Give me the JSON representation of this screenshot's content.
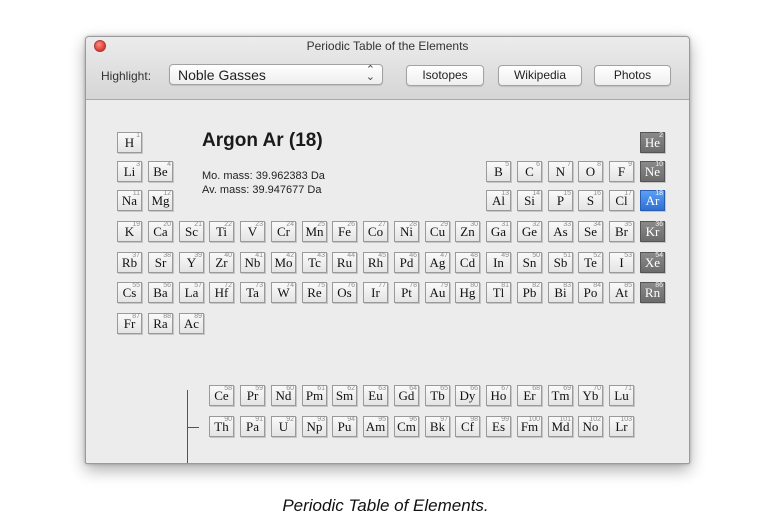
{
  "window": {
    "title": "Periodic Table of the Elements"
  },
  "toolbar": {
    "highlight_label": "Highlight:",
    "highlight_value": "Noble Gasses",
    "buttons": [
      "Isotopes",
      "Wikipedia",
      "Photos"
    ]
  },
  "selected": {
    "heading": "Argon Ar (18)",
    "mo_mass": "Mo. mass: 39.962383 Da",
    "av_mass": "Av. mass: 39.947677 Da"
  },
  "caption": "Periodic Table of Elements.",
  "colors": {
    "noble": "#767676",
    "selected": "#3d7fe0"
  },
  "elements": [
    {
      "n": 1,
      "s": "H",
      "p": 1,
      "g": 1
    },
    {
      "n": 2,
      "s": "He",
      "p": 1,
      "g": 18,
      "noble": true
    },
    {
      "n": 3,
      "s": "Li",
      "p": 2,
      "g": 1
    },
    {
      "n": 4,
      "s": "Be",
      "p": 2,
      "g": 2
    },
    {
      "n": 5,
      "s": "B",
      "p": 2,
      "g": 13
    },
    {
      "n": 6,
      "s": "C",
      "p": 2,
      "g": 14
    },
    {
      "n": 7,
      "s": "N",
      "p": 2,
      "g": 15
    },
    {
      "n": 8,
      "s": "O",
      "p": 2,
      "g": 16
    },
    {
      "n": 9,
      "s": "F",
      "p": 2,
      "g": 17
    },
    {
      "n": 10,
      "s": "Ne",
      "p": 2,
      "g": 18,
      "noble": true
    },
    {
      "n": 11,
      "s": "Na",
      "p": 3,
      "g": 1
    },
    {
      "n": 12,
      "s": "Mg",
      "p": 3,
      "g": 2
    },
    {
      "n": 13,
      "s": "Al",
      "p": 3,
      "g": 13
    },
    {
      "n": 14,
      "s": "Si",
      "p": 3,
      "g": 14
    },
    {
      "n": 15,
      "s": "P",
      "p": 3,
      "g": 15
    },
    {
      "n": 16,
      "s": "S",
      "p": 3,
      "g": 16
    },
    {
      "n": 17,
      "s": "Cl",
      "p": 3,
      "g": 17
    },
    {
      "n": 18,
      "s": "Ar",
      "p": 3,
      "g": 18,
      "selected": true
    },
    {
      "n": 19,
      "s": "K",
      "p": 4,
      "g": 1
    },
    {
      "n": 20,
      "s": "Ca",
      "p": 4,
      "g": 2
    },
    {
      "n": 21,
      "s": "Sc",
      "p": 4,
      "g": 3
    },
    {
      "n": 22,
      "s": "Ti",
      "p": 4,
      "g": 4
    },
    {
      "n": 23,
      "s": "V",
      "p": 4,
      "g": 5
    },
    {
      "n": 24,
      "s": "Cr",
      "p": 4,
      "g": 6
    },
    {
      "n": 25,
      "s": "Mn",
      "p": 4,
      "g": 7
    },
    {
      "n": 26,
      "s": "Fe",
      "p": 4,
      "g": 8
    },
    {
      "n": 27,
      "s": "Co",
      "p": 4,
      "g": 9
    },
    {
      "n": 28,
      "s": "Ni",
      "p": 4,
      "g": 10
    },
    {
      "n": 29,
      "s": "Cu",
      "p": 4,
      "g": 11
    },
    {
      "n": 30,
      "s": "Zn",
      "p": 4,
      "g": 12
    },
    {
      "n": 31,
      "s": "Ga",
      "p": 4,
      "g": 13
    },
    {
      "n": 32,
      "s": "Ge",
      "p": 4,
      "g": 14
    },
    {
      "n": 33,
      "s": "As",
      "p": 4,
      "g": 15
    },
    {
      "n": 34,
      "s": "Se",
      "p": 4,
      "g": 16
    },
    {
      "n": 35,
      "s": "Br",
      "p": 4,
      "g": 17
    },
    {
      "n": 36,
      "s": "Kr",
      "p": 4,
      "g": 18,
      "noble": true
    },
    {
      "n": 37,
      "s": "Rb",
      "p": 5,
      "g": 1
    },
    {
      "n": 38,
      "s": "Sr",
      "p": 5,
      "g": 2
    },
    {
      "n": 39,
      "s": "Y",
      "p": 5,
      "g": 3
    },
    {
      "n": 40,
      "s": "Zr",
      "p": 5,
      "g": 4
    },
    {
      "n": 41,
      "s": "Nb",
      "p": 5,
      "g": 5
    },
    {
      "n": 42,
      "s": "Mo",
      "p": 5,
      "g": 6
    },
    {
      "n": 43,
      "s": "Tc",
      "p": 5,
      "g": 7
    },
    {
      "n": 44,
      "s": "Ru",
      "p": 5,
      "g": 8
    },
    {
      "n": 45,
      "s": "Rh",
      "p": 5,
      "g": 9
    },
    {
      "n": 46,
      "s": "Pd",
      "p": 5,
      "g": 10
    },
    {
      "n": 47,
      "s": "Ag",
      "p": 5,
      "g": 11
    },
    {
      "n": 48,
      "s": "Cd",
      "p": 5,
      "g": 12
    },
    {
      "n": 49,
      "s": "In",
      "p": 5,
      "g": 13
    },
    {
      "n": 50,
      "s": "Sn",
      "p": 5,
      "g": 14
    },
    {
      "n": 51,
      "s": "Sb",
      "p": 5,
      "g": 15
    },
    {
      "n": 52,
      "s": "Te",
      "p": 5,
      "g": 16
    },
    {
      "n": 53,
      "s": "I",
      "p": 5,
      "g": 17
    },
    {
      "n": 54,
      "s": "Xe",
      "p": 5,
      "g": 18,
      "noble": true
    },
    {
      "n": 55,
      "s": "Cs",
      "p": 6,
      "g": 1
    },
    {
      "n": 56,
      "s": "Ba",
      "p": 6,
      "g": 2
    },
    {
      "n": 57,
      "s": "La",
      "p": 6,
      "g": 3
    },
    {
      "n": 72,
      "s": "Hf",
      "p": 6,
      "g": 4
    },
    {
      "n": 73,
      "s": "Ta",
      "p": 6,
      "g": 5
    },
    {
      "n": 74,
      "s": "W",
      "p": 6,
      "g": 6
    },
    {
      "n": 75,
      "s": "Re",
      "p": 6,
      "g": 7
    },
    {
      "n": 76,
      "s": "Os",
      "p": 6,
      "g": 8
    },
    {
      "n": 77,
      "s": "Ir",
      "p": 6,
      "g": 9
    },
    {
      "n": 78,
      "s": "Pt",
      "p": 6,
      "g": 10
    },
    {
      "n": 79,
      "s": "Au",
      "p": 6,
      "g": 11
    },
    {
      "n": 80,
      "s": "Hg",
      "p": 6,
      "g": 12
    },
    {
      "n": 81,
      "s": "Tl",
      "p": 6,
      "g": 13
    },
    {
      "n": 82,
      "s": "Pb",
      "p": 6,
      "g": 14
    },
    {
      "n": 83,
      "s": "Bi",
      "p": 6,
      "g": 15
    },
    {
      "n": 84,
      "s": "Po",
      "p": 6,
      "g": 16
    },
    {
      "n": 85,
      "s": "At",
      "p": 6,
      "g": 17
    },
    {
      "n": 86,
      "s": "Rn",
      "p": 6,
      "g": 18,
      "noble": true
    },
    {
      "n": 87,
      "s": "Fr",
      "p": 7,
      "g": 1
    },
    {
      "n": 88,
      "s": "Ra",
      "p": 7,
      "g": 2
    },
    {
      "n": 89,
      "s": "Ac",
      "p": 7,
      "g": 3
    },
    {
      "n": 58,
      "s": "Ce",
      "p": 9,
      "g": 4
    },
    {
      "n": 59,
      "s": "Pr",
      "p": 9,
      "g": 5
    },
    {
      "n": 60,
      "s": "Nd",
      "p": 9,
      "g": 6
    },
    {
      "n": 61,
      "s": "Pm",
      "p": 9,
      "g": 7
    },
    {
      "n": 62,
      "s": "Sm",
      "p": 9,
      "g": 8
    },
    {
      "n": 63,
      "s": "Eu",
      "p": 9,
      "g": 9
    },
    {
      "n": 64,
      "s": "Gd",
      "p": 9,
      "g": 10
    },
    {
      "n": 65,
      "s": "Tb",
      "p": 9,
      "g": 11
    },
    {
      "n": 66,
      "s": "Dy",
      "p": 9,
      "g": 12
    },
    {
      "n": 67,
      "s": "Ho",
      "p": 9,
      "g": 13
    },
    {
      "n": 68,
      "s": "Er",
      "p": 9,
      "g": 14
    },
    {
      "n": 69,
      "s": "Tm",
      "p": 9,
      "g": 15
    },
    {
      "n": 70,
      "s": "Yb",
      "p": 9,
      "g": 16
    },
    {
      "n": 71,
      "s": "Lu",
      "p": 9,
      "g": 17
    },
    {
      "n": 90,
      "s": "Th",
      "p": 10,
      "g": 4
    },
    {
      "n": 91,
      "s": "Pa",
      "p": 10,
      "g": 5
    },
    {
      "n": 92,
      "s": "U",
      "p": 10,
      "g": 6
    },
    {
      "n": 93,
      "s": "Np",
      "p": 10,
      "g": 7
    },
    {
      "n": 94,
      "s": "Pu",
      "p": 10,
      "g": 8
    },
    {
      "n": 95,
      "s": "Am",
      "p": 10,
      "g": 9
    },
    {
      "n": 96,
      "s": "Cm",
      "p": 10,
      "g": 10
    },
    {
      "n": 97,
      "s": "Bk",
      "p": 10,
      "g": 11
    },
    {
      "n": 98,
      "s": "Cf",
      "p": 10,
      "g": 12
    },
    {
      "n": 99,
      "s": "Es",
      "p": 10,
      "g": 13
    },
    {
      "n": 100,
      "s": "Fm",
      "p": 10,
      "g": 14
    },
    {
      "n": 101,
      "s": "Md",
      "p": 10,
      "g": 15
    },
    {
      "n": 102,
      "s": "No",
      "p": 10,
      "g": 16
    },
    {
      "n": 103,
      "s": "Lr",
      "p": 10,
      "g": 17
    }
  ]
}
